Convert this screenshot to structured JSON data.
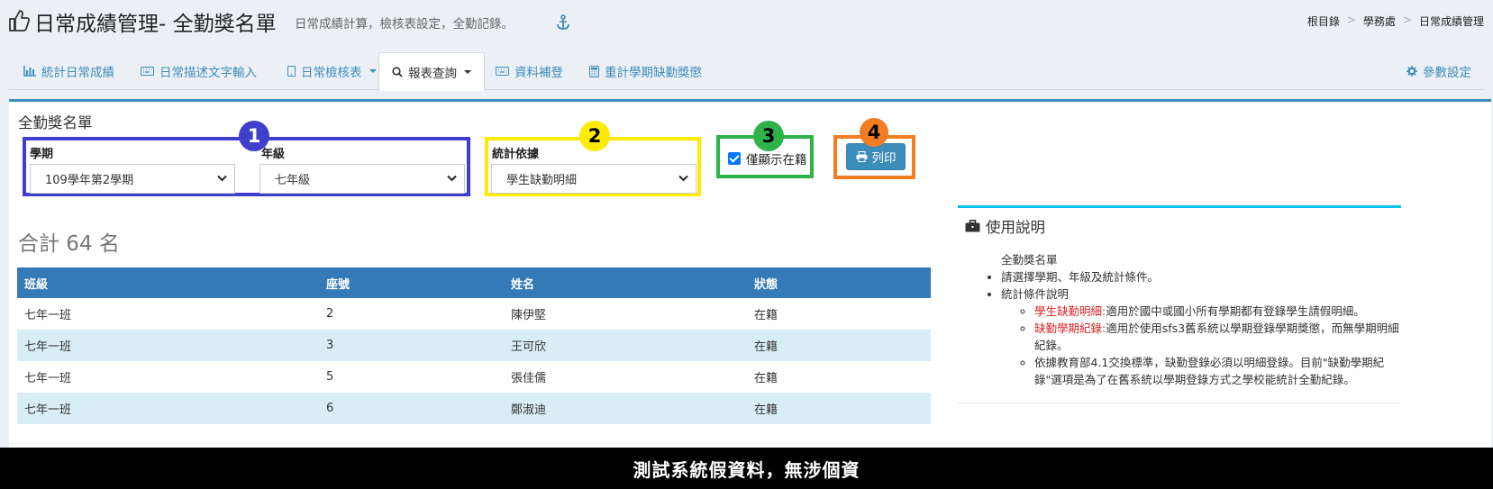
{
  "header": {
    "title": "日常成績管理- 全勤獎名單",
    "subtitle": "日常成績計算，檢核表設定，全勤記錄。",
    "breadcrumb": [
      "根目錄",
      "學務處",
      "日常成績管理"
    ]
  },
  "tabs": [
    {
      "label": "統計日常成績",
      "icon": "bar-chart-icon"
    },
    {
      "label": "日常描述文字輸入",
      "icon": "keyboard-icon"
    },
    {
      "label": "日常檢核表",
      "icon": "tablet-icon",
      "dropdown": true
    },
    {
      "label": "報表查詢",
      "icon": "search-icon",
      "dropdown": true,
      "active": true
    },
    {
      "label": "資料補登",
      "icon": "keyboard-icon"
    },
    {
      "label": "重計學期缺勤獎懲",
      "icon": "calculator-icon"
    }
  ],
  "settings_label": "參數設定",
  "form": {
    "box_title": "全勤獎名單",
    "semester_label": "學期",
    "semester_value": "109學年第2學期",
    "grade_label": "年級",
    "grade_value": "七年級",
    "basis_label": "統計依據",
    "basis_value": "學生缺勤明細",
    "enrolled_only_label": "僅顯示在籍",
    "enrolled_only_checked": true,
    "print_label": "列印"
  },
  "badges": [
    "1",
    "2",
    "3",
    "4"
  ],
  "total_text": "合計 64 名",
  "table": {
    "headers": [
      "班級",
      "座號",
      "姓名",
      "狀態"
    ],
    "rows": [
      [
        "七年一班",
        "2",
        "陳伊堅",
        "在籍"
      ],
      [
        "七年一班",
        "3",
        "王可欣",
        "在籍"
      ],
      [
        "七年一班",
        "5",
        "張佳儒",
        "在籍"
      ],
      [
        "七年一班",
        "6",
        "鄭淑迪",
        "在籍"
      ]
    ]
  },
  "instructions": {
    "title": "使用說明",
    "heading": "全勤獎名單",
    "item1": "請選擇學期、年級及統計條件。",
    "item2": "統計條件說明",
    "sub1_key": "學生缺勤明細:",
    "sub1_text": "適用於國中或國小所有學期都有登錄學生請假明細。",
    "sub2_key": "缺勤學期紀錄:",
    "sub2_text": "適用於使用sfs3舊系統以學期登錄學期獎懲，而無學期明細紀錄。",
    "sub3_text": "依據教育部4.1交換標準，缺勤登錄必須以明細登錄。目前\"缺勤學期紀錄\"選項是為了在舊系統以學期登錄方式之學校能統計全勤紀錄。"
  },
  "footer_text": "測試系統假資料，無涉個資",
  "colors": {
    "primary": "#3c8dbc",
    "table_header": "#337ab7",
    "stripe": "#d9edf7",
    "outline_1": "#3f3fcc",
    "outline_2": "#ffeb00",
    "outline_3": "#2db34a",
    "outline_4": "#f47c22"
  }
}
